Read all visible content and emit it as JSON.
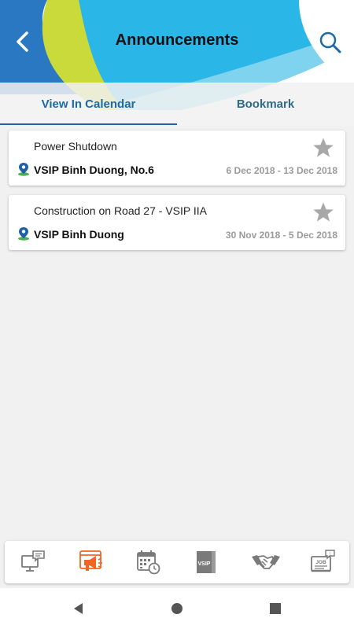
{
  "header": {
    "title": "Announcements",
    "back_icon": "chevron-left-icon",
    "search_icon": "search-icon"
  },
  "tabs": [
    {
      "label": "View In Calendar",
      "active": true
    },
    {
      "label": "Bookmark",
      "active": false
    }
  ],
  "announcements": [
    {
      "title": "Power Shutdown",
      "location": "VSIP Binh Duong, No.6",
      "date_range": "6 Dec 2018 - 13 Dec 2018",
      "bookmarked": false
    },
    {
      "title": "Construction on Road 27 - VSIP IIA",
      "location": "VSIP Binh Duong",
      "date_range": "30 Nov 2018 - 5 Dec 2018",
      "bookmarked": false
    }
  ],
  "bottom_nav": [
    {
      "icon": "computer-chat-icon"
    },
    {
      "icon": "megaphone-icon",
      "active": true
    },
    {
      "icon": "calendar-clock-icon"
    },
    {
      "icon": "vsip-book-icon",
      "label": "VSIP"
    },
    {
      "icon": "handshake-icon"
    },
    {
      "icon": "job-board-icon",
      "label": "JOB"
    }
  ],
  "colors": {
    "accent": "#1a6aa8",
    "active_nav": "#f26522",
    "inactive_nav": "#7a7a7a",
    "star": "#a8a8a8",
    "pin_blue": "#1f5fa8",
    "pin_green": "#4caf50"
  }
}
